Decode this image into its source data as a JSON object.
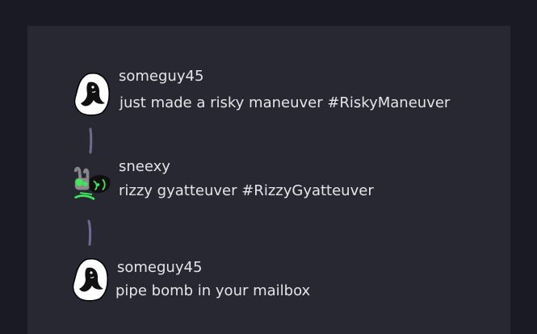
{
  "posts": [
    {
      "username": "someguy45",
      "message": "just made a risky maneuver #RiskyManeuver",
      "avatar": "ghost-sketch-avatar"
    },
    {
      "username": "sneexy",
      "message": "rizzy gyatteuver #RizzyGyatteuver",
      "avatar": "creature-sketch-avatar"
    },
    {
      "username": "someguy45",
      "message": "pipe bomb in your mailbox",
      "avatar": "ghost-sketch-avatar"
    }
  ],
  "colors": {
    "page_background": "#1a1a24",
    "panel_background": "#282833",
    "text": "#e4e4ec",
    "thread_line": "#6e6a92",
    "accent_green": "#3fe85a"
  }
}
